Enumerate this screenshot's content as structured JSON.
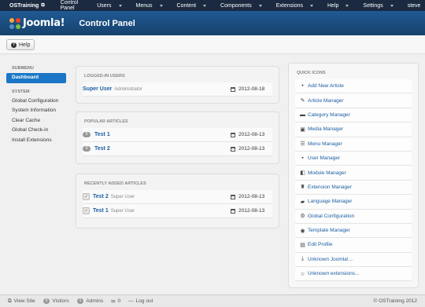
{
  "topbar": {
    "brand": "OSTraining",
    "menus": [
      "Control Panel",
      "Users",
      "Menus",
      "Content",
      "Components",
      "Extensions",
      "Help"
    ],
    "right": [
      "Settings",
      "steve"
    ]
  },
  "header": {
    "logo_text": "Joomla!",
    "page_title": "Control Panel"
  },
  "toolbar": {
    "help_label": "Help"
  },
  "sidebar": {
    "submenu_heading": "SUBMENU",
    "dashboard": "Dashboard",
    "system_heading": "SYSTEM",
    "items": [
      "Global Configuration",
      "System Information",
      "Clear Cache",
      "Global Check-in",
      "Install Extensions"
    ]
  },
  "logged_in": {
    "title": "LOGGED-IN USERS",
    "rows": [
      {
        "name": "Super User",
        "role": "Administrator",
        "date": "2012-08-18"
      }
    ]
  },
  "popular": {
    "title": "POPULAR ARTICLES",
    "rows": [
      {
        "hits": "0",
        "name": "Test 1",
        "date": "2012-08-13"
      },
      {
        "hits": "0",
        "name": "Test 2",
        "date": "2012-08-13"
      }
    ]
  },
  "recent": {
    "title": "RECENTLY ADDED ARTICLES",
    "rows": [
      {
        "name": "Test 2",
        "author": "Super User",
        "date": "2012-08-13"
      },
      {
        "name": "Test 1",
        "author": "Super User",
        "date": "2012-08-13"
      }
    ]
  },
  "quick": {
    "title": "QUICK ICONS",
    "items": [
      {
        "label": "Add New Article",
        "icon": "plus-icon"
      },
      {
        "label": "Article Manager",
        "icon": "pencil-icon"
      },
      {
        "label": "Category Manager",
        "icon": "folder-icon"
      },
      {
        "label": "Media Manager",
        "icon": "image-icon"
      },
      {
        "label": "Menu Manager",
        "icon": "list-icon"
      },
      {
        "label": "User Manager",
        "icon": "user-icon"
      },
      {
        "label": "Module Manager",
        "icon": "cube-icon"
      },
      {
        "label": "Extension Manager",
        "icon": "puzzle-icon"
      },
      {
        "label": "Language Manager",
        "icon": "comment-icon"
      },
      {
        "label": "Global Configuration",
        "icon": "gear-icon"
      },
      {
        "label": "Template Manager",
        "icon": "eye-icon"
      },
      {
        "label": "Edit Profile",
        "icon": "profile-icon"
      },
      {
        "label": "Unknown Joomla!...",
        "icon": "download-icon"
      },
      {
        "label": "Unknown extensions...",
        "icon": "star-icon"
      }
    ]
  },
  "footer": {
    "view_site": "View Site",
    "visitors_count": "0",
    "visitors": "Visitors",
    "admins_count": "1",
    "admins": "Admins",
    "messages": "0",
    "logout": "Log out",
    "copyright": "© OSTraining 2012"
  }
}
